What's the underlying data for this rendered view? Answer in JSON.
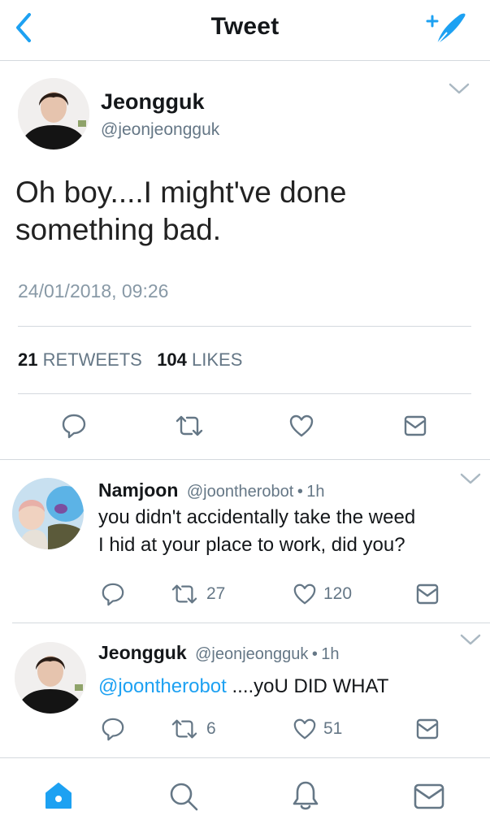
{
  "header": {
    "title": "Tweet"
  },
  "main_tweet": {
    "name": "Jeongguk",
    "handle": "@jeonjeongguk",
    "text_line1": "Oh boy....I might've done",
    "text_line2": "something bad.",
    "timestamp": "24/01/2018, 09:26",
    "retweets_count": "21",
    "retweets_label": "RETWEETS",
    "likes_count": "104",
    "likes_label": "LIKES"
  },
  "replies": [
    {
      "name": "Namjoon",
      "handle": "@joontherobot",
      "dot": "•",
      "time": "1h",
      "text_line1": "you didn't accidentally take the weed",
      "text_line2": "I hid at your place to work, did you?",
      "retweets": "27",
      "likes": "120"
    },
    {
      "name": "Jeongguk",
      "handle": "@jeonjeongguk",
      "dot": "•",
      "time": "1h",
      "mention": "@joontherobot",
      "text_rest": " ....yoU DID WHAT",
      "retweets": "6",
      "likes": "51"
    }
  ],
  "icons": {
    "back": "chevron-left-icon",
    "compose": "compose-tweet-icon",
    "more": "chevron-down-icon",
    "reply": "reply-icon",
    "retweet": "retweet-icon",
    "like": "heart-icon",
    "dm": "envelope-icon",
    "home": "home-icon",
    "search": "search-icon",
    "notifications": "bell-icon",
    "messages": "envelope-icon"
  },
  "colors": {
    "accent": "#1da1f2",
    "text": "#14171a",
    "secondary": "#657786",
    "divider": "#d4d9de"
  }
}
